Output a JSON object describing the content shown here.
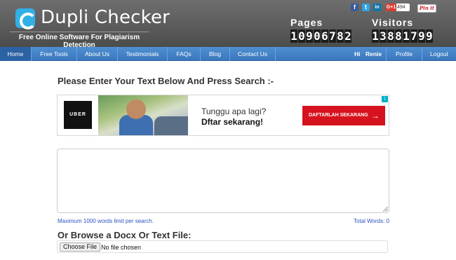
{
  "header": {
    "logo_text": "Dupli Checker",
    "tagline": "Free Online Software For Plagiarism Detection",
    "social": {
      "facebook": "f",
      "twitter": "t",
      "linkedin": "in",
      "gplus_label": "G+1",
      "gplus_count": "494",
      "pinterest": "Pin it"
    },
    "pages_label": "Pages",
    "pages_value": "10906782",
    "visitors_label": "Visitors",
    "visitors_value": "13881799"
  },
  "nav": {
    "items": [
      {
        "label": "Home"
      },
      {
        "label": "Free Tools"
      },
      {
        "label": "About Us"
      },
      {
        "label": "Testimonials"
      },
      {
        "label": "FAQs"
      },
      {
        "label": "Blog"
      },
      {
        "label": "Contact Us"
      }
    ],
    "greeting": "Hi",
    "user": "Renie",
    "profile": "Profile",
    "logout": "Logout"
  },
  "main": {
    "heading": "Please Enter Your Text Below And Press Search :-",
    "ad": {
      "brand": "UBER",
      "line1": "Tunggu apa lagi?",
      "line2": "Dftar sekarang!",
      "cta": "DAFTARLAH SEKARANG"
    },
    "textarea_value": "",
    "limit_note": "Maximum 1000 words limit per search.",
    "total_words": "Total Words: 0",
    "browse_heading": "Or Browse a Docx Or Text File:",
    "file_button": "Choose File",
    "file_status": "No file chosen"
  },
  "colors": {
    "header_bg": "#5a5a5a",
    "nav_bg": "#3a78bd",
    "link_blue": "#2a52be",
    "ad_red": "#d6121e"
  }
}
